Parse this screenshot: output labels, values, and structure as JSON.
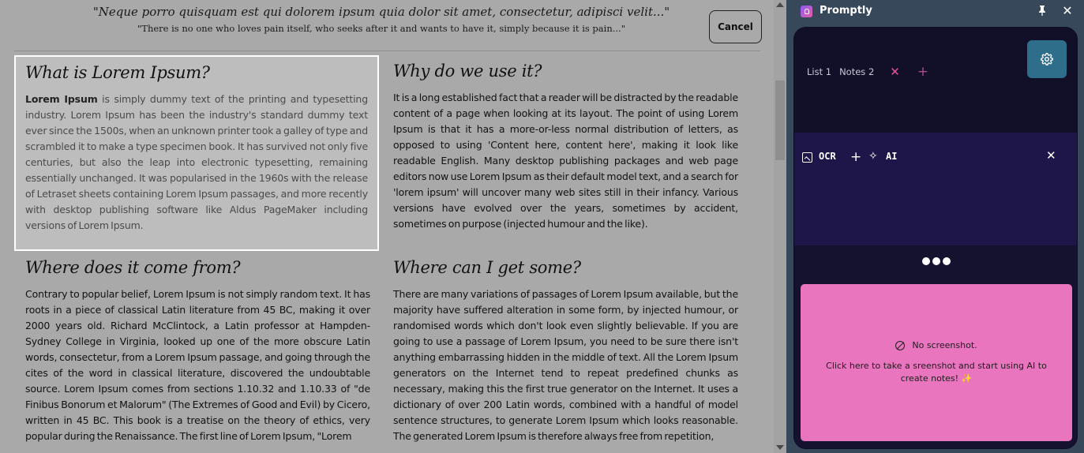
{
  "webpage": {
    "quote_latin": "\"Neque porro quisquam est qui dolorem ipsum quia dolor sit amet, consectetur, adipisci velit...\"",
    "quote_english": "\"There is no one who loves pain itself, who seeks after it and wants to have it, simply because it is pain...\"",
    "cancel_label": "Cancel",
    "sections": [
      {
        "heading": "What is Lorem Ipsum?",
        "bold_lead": "Lorem Ipsum",
        "body": " is simply dummy text of the printing and typesetting industry. Lorem Ipsum has been the industry's standard dummy text ever since the 1500s, when an unknown printer took a galley of type and scrambled it to make a type specimen book. It has survived not only five centuries, but also the leap into electronic typesetting, remaining essentially unchanged. It was popularised in the 1960s with the release of Letraset sheets containing Lorem Ipsum passages, and more recently with desktop publishing software like Aldus PageMaker including versions of Lorem Ipsum."
      },
      {
        "heading": "Why do we use it?",
        "body": "It is a long established fact that a reader will be distracted by the readable content of a page when looking at its layout. The point of using Lorem Ipsum is that it has a more-or-less normal distribution of letters, as opposed to using 'Content here, content here', making it look like readable English. Many desktop publishing packages and web page editors now use Lorem Ipsum as their default model text, and a search for 'lorem ipsum' will uncover many web sites still in their infancy. Various versions have evolved over the years, sometimes by accident, sometimes on purpose (injected humour and the like)."
      },
      {
        "heading": "Where does it come from?",
        "body": "Contrary to popular belief, Lorem Ipsum is not simply random text. It has roots in a piece of classical Latin literature from 45 BC, making it over 2000 years old. Richard McClintock, a Latin professor at Hampden-Sydney College in Virginia, looked up one of the more obscure Latin words, consectetur, from a Lorem Ipsum passage, and going through the cites of the word in classical literature, discovered the undoubtable source. Lorem Ipsum comes from sections 1.10.32 and 1.10.33 of \"de Finibus Bonorum et Malorum\" (The Extremes of Good and Evil) by Cicero, written in 45 BC. This book is a treatise on the theory of ethics, very popular during the Renaissance. The first line of Lorem Ipsum, \"Lorem"
      },
      {
        "heading": "Where can I get some?",
        "body": "There are many variations of passages of Lorem Ipsum available, but the majority have suffered alteration in some form, by injected humour, or randomised words which don't look even slightly believable. If you are going to use a passage of Lorem Ipsum, you need to be sure there isn't anything embarrassing hidden in the middle of text. All the Lorem Ipsum generators on the Internet tend to repeat predefined chunks as necessary, making this the first true generator on the Internet. It uses a dictionary of over 200 Latin words, combined with a handful of model sentence structures, to generate Lorem Ipsum which looks reasonable. The generated Lorem Ipsum is therefore always free from repetition,"
      }
    ]
  },
  "panel": {
    "app_title": "Promptly",
    "tabs": [
      {
        "label": "List 1"
      },
      {
        "label": "Notes 2"
      }
    ],
    "toolbar": {
      "ocr_label": "OCR",
      "ai_label": "AI"
    },
    "screenshot_card": {
      "status": "No screenshot.",
      "cta": "Click here to take a sreenshot and start using AI to create notes!",
      "cta_emoji": "✨"
    }
  },
  "colors": {
    "panel_bg": "#36485a",
    "app_bg": "#151230",
    "toolbar_bg": "#1e1648",
    "settings_button": "#2f6e8a",
    "card_pink": "#e875be",
    "tab_close": "#e2559a"
  },
  "icons": [
    "promptly-logo-icon",
    "pin-icon",
    "close-icon",
    "gear-icon",
    "tab-close-icon",
    "add-tab-icon",
    "image-ocr-icon",
    "plus-icon",
    "sparkle-icon",
    "no-entry-icon",
    "scroll-up-icon",
    "scroll-down-icon"
  ]
}
